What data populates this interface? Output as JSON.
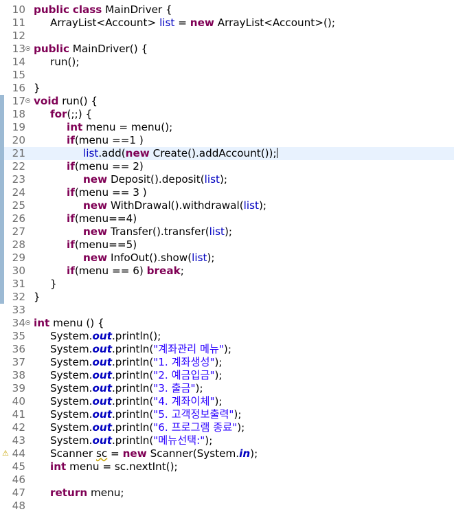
{
  "editor": {
    "current_line": 21,
    "lines": [
      {
        "n": 10,
        "tokens": [
          [
            "kw",
            "public"
          ],
          [
            "t",
            " "
          ],
          [
            "kw",
            "class"
          ],
          [
            "t",
            " MainDriver {"
          ]
        ]
      },
      {
        "n": 11,
        "indent": 1,
        "tokens": [
          [
            "t",
            "ArrayList<Account> "
          ],
          [
            "fld",
            "list"
          ],
          [
            "t",
            " = "
          ],
          [
            "kw",
            "new"
          ],
          [
            "t",
            " ArrayList<Account>();"
          ]
        ]
      },
      {
        "n": 12,
        "tokens": []
      },
      {
        "n": 13,
        "fold": true,
        "tokens": [
          [
            "kw",
            "public"
          ],
          [
            "t",
            " MainDriver() {"
          ]
        ]
      },
      {
        "n": 14,
        "indent": 1,
        "tokens": [
          [
            "t",
            "run();"
          ]
        ]
      },
      {
        "n": 15,
        "tokens": []
      },
      {
        "n": 16,
        "tokens": [
          [
            "t",
            "}"
          ]
        ]
      },
      {
        "n": 17,
        "fold": true,
        "marker": true,
        "tokens": [
          [
            "kw",
            "void"
          ],
          [
            "t",
            " run() {"
          ]
        ]
      },
      {
        "n": 18,
        "marker": true,
        "indent": 1,
        "tokens": [
          [
            "kw",
            "for"
          ],
          [
            "t",
            "(;;) {"
          ]
        ]
      },
      {
        "n": 19,
        "marker": true,
        "indent": 2,
        "tokens": [
          [
            "kw",
            "int"
          ],
          [
            "t",
            " menu = menu();"
          ]
        ]
      },
      {
        "n": 20,
        "marker": true,
        "indent": 2,
        "tokens": [
          [
            "kw",
            "if"
          ],
          [
            "t",
            "(menu ==1 )"
          ]
        ]
      },
      {
        "n": 21,
        "marker": true,
        "indent": 3,
        "caret": true,
        "tokens": [
          [
            "fld",
            "list"
          ],
          [
            "t",
            ".add("
          ],
          [
            "kw",
            "new"
          ],
          [
            "t",
            " Create().addAccount());"
          ]
        ]
      },
      {
        "n": 22,
        "marker": true,
        "indent": 2,
        "tokens": [
          [
            "kw",
            "if"
          ],
          [
            "t",
            "(menu == 2)"
          ]
        ]
      },
      {
        "n": 23,
        "marker": true,
        "indent": 3,
        "tokens": [
          [
            "kw",
            "new"
          ],
          [
            "t",
            " Deposit().deposit("
          ],
          [
            "fld",
            "list"
          ],
          [
            "t",
            ");"
          ]
        ]
      },
      {
        "n": 24,
        "marker": true,
        "indent": 2,
        "tokens": [
          [
            "kw",
            "if"
          ],
          [
            "t",
            "(menu == 3 )"
          ]
        ]
      },
      {
        "n": 25,
        "marker": true,
        "indent": 3,
        "tokens": [
          [
            "kw",
            "new"
          ],
          [
            "t",
            " WithDrawal().withdrawal("
          ],
          [
            "fld",
            "list"
          ],
          [
            "t",
            ");"
          ]
        ]
      },
      {
        "n": 26,
        "marker": true,
        "indent": 2,
        "tokens": [
          [
            "kw",
            "if"
          ],
          [
            "t",
            "(menu==4)"
          ]
        ]
      },
      {
        "n": 27,
        "marker": true,
        "indent": 3,
        "tokens": [
          [
            "kw",
            "new"
          ],
          [
            "t",
            " Transfer().transfer("
          ],
          [
            "fld",
            "list"
          ],
          [
            "t",
            ");"
          ]
        ]
      },
      {
        "n": 28,
        "marker": true,
        "indent": 2,
        "tokens": [
          [
            "kw",
            "if"
          ],
          [
            "t",
            "(menu==5)"
          ]
        ]
      },
      {
        "n": 29,
        "marker": true,
        "indent": 3,
        "tokens": [
          [
            "kw",
            "new"
          ],
          [
            "t",
            " InfoOut().show("
          ],
          [
            "fld",
            "list"
          ],
          [
            "t",
            ");"
          ]
        ]
      },
      {
        "n": 30,
        "marker": true,
        "indent": 2,
        "tokens": [
          [
            "kw",
            "if"
          ],
          [
            "t",
            "(menu == 6) "
          ],
          [
            "kw",
            "break"
          ],
          [
            "t",
            ";"
          ]
        ]
      },
      {
        "n": 31,
        "marker": true,
        "indent": 1,
        "tokens": [
          [
            "t",
            "}"
          ]
        ]
      },
      {
        "n": 32,
        "marker": true,
        "tokens": [
          [
            "t",
            "}"
          ]
        ]
      },
      {
        "n": 33,
        "tokens": []
      },
      {
        "n": 34,
        "fold": true,
        "tokens": [
          [
            "kw",
            "int"
          ],
          [
            "t",
            " menu () {"
          ]
        ]
      },
      {
        "n": 35,
        "indent": 1,
        "tokens": [
          [
            "t",
            "System."
          ],
          [
            "sf",
            "out"
          ],
          [
            "t",
            ".println();"
          ]
        ]
      },
      {
        "n": 36,
        "indent": 1,
        "tokens": [
          [
            "t",
            "System."
          ],
          [
            "sf",
            "out"
          ],
          [
            "t",
            ".println("
          ],
          [
            "str",
            "\"계좌관리 메뉴\""
          ],
          [
            "t",
            ");"
          ]
        ]
      },
      {
        "n": 37,
        "indent": 1,
        "tokens": [
          [
            "t",
            "System."
          ],
          [
            "sf",
            "out"
          ],
          [
            "t",
            ".println("
          ],
          [
            "str",
            "\"1. 계좌생성\""
          ],
          [
            "t",
            ");"
          ]
        ]
      },
      {
        "n": 38,
        "indent": 1,
        "tokens": [
          [
            "t",
            "System."
          ],
          [
            "sf",
            "out"
          ],
          [
            "t",
            ".println("
          ],
          [
            "str",
            "\"2. 예금입금\""
          ],
          [
            "t",
            ");"
          ]
        ]
      },
      {
        "n": 39,
        "indent": 1,
        "tokens": [
          [
            "t",
            "System."
          ],
          [
            "sf",
            "out"
          ],
          [
            "t",
            ".println("
          ],
          [
            "str",
            "\"3. 출금\""
          ],
          [
            "t",
            ");"
          ]
        ]
      },
      {
        "n": 40,
        "indent": 1,
        "tokens": [
          [
            "t",
            "System."
          ],
          [
            "sf",
            "out"
          ],
          [
            "t",
            ".println("
          ],
          [
            "str",
            "\"4. 계좌이체\""
          ],
          [
            "t",
            ");"
          ]
        ]
      },
      {
        "n": 41,
        "indent": 1,
        "tokens": [
          [
            "t",
            "System."
          ],
          [
            "sf",
            "out"
          ],
          [
            "t",
            ".println("
          ],
          [
            "str",
            "\"5. 고객정보출력\""
          ],
          [
            "t",
            ");"
          ]
        ]
      },
      {
        "n": 42,
        "indent": 1,
        "tokens": [
          [
            "t",
            "System."
          ],
          [
            "sf",
            "out"
          ],
          [
            "t",
            ".println("
          ],
          [
            "str",
            "\"6. 프로그램 종료\""
          ],
          [
            "t",
            ");"
          ]
        ]
      },
      {
        "n": 43,
        "indent": 1,
        "tokens": [
          [
            "t",
            "System."
          ],
          [
            "sf",
            "out"
          ],
          [
            "t",
            ".println("
          ],
          [
            "str",
            "\"메뉴선택:\""
          ],
          [
            "t",
            ");"
          ]
        ]
      },
      {
        "n": 44,
        "indent": 1,
        "warning": true,
        "tokens": [
          [
            "t",
            "Scanner "
          ],
          [
            "sq",
            "sc"
          ],
          [
            "t",
            " = "
          ],
          [
            "kw",
            "new"
          ],
          [
            "t",
            " Scanner(System."
          ],
          [
            "sf",
            "in"
          ],
          [
            "t",
            ");"
          ]
        ]
      },
      {
        "n": 45,
        "indent": 1,
        "tokens": [
          [
            "kw",
            "int"
          ],
          [
            "t",
            " menu = sc.nextInt();"
          ]
        ]
      },
      {
        "n": 46,
        "tokens": []
      },
      {
        "n": 47,
        "indent": 1,
        "tokens": [
          [
            "kw",
            "return"
          ],
          [
            "t",
            " menu;"
          ]
        ]
      },
      {
        "n": 48,
        "tokens": []
      }
    ]
  }
}
